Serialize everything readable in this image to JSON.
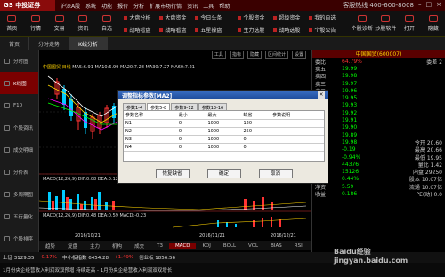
{
  "app": {
    "logo": "GS 中投证券",
    "menu": [
      "沪深A股",
      "系统",
      "功能",
      "报价",
      "分析",
      "扩展市场行情",
      "资讯",
      "工具",
      "帮助"
    ],
    "phone": "客服热线 400-600-8008"
  },
  "toolbar": {
    "buttons": [
      {
        "label": "首页"
      },
      {
        "label": "行情"
      },
      {
        "label": "交易"
      },
      {
        "label": "资讯"
      },
      {
        "label": "自选"
      }
    ],
    "groups": [
      [
        "大盘分析",
        "大盘资金",
        "今日头条"
      ],
      [
        "战略看盘",
        "战略看盘",
        "五星操盘"
      ],
      [
        "个股资金",
        "超级资金",
        "我的自选"
      ],
      [
        "主力选股",
        "战略选股",
        "个股公告"
      ]
    ],
    "right": [
      "个股诊断",
      "炒股软件",
      "打开",
      "隐藏"
    ]
  },
  "tabs": [
    "首页",
    "分时走势",
    "K线分析"
  ],
  "sidebar": [
    "分时图",
    "K线图",
    "F10",
    "个股资讯",
    "成交明细",
    "分价表",
    "多周期图",
    "五行量化",
    "个股排序"
  ],
  "chart": {
    "stock": "中国国贸 日线",
    "ma": "MA5:6.91 MA10:6.99 MA20:7.28 MA30:7.27 MA60:7.21",
    "links": [
      "工具",
      "指标",
      "隐藏",
      "区间统计",
      "设置"
    ],
    "macd1": "MACD(12,26,9) DIF:0.08 DEA:0.12 MACD:-0.07",
    "macd2": "MACD(12,26,9) DIF:0.48 DEA:0.59 MACD:-0.23",
    "dates": [
      "2016/10/21",
      "2016/11/21",
      "2016/12/21"
    ]
  },
  "bottomtabs": [
    "趋势",
    "复盘",
    "主力",
    "机构",
    "成交",
    "T3",
    "MACD",
    "KDJ",
    "BOLL",
    "VOL",
    "BIAS",
    "RSI"
  ],
  "dialog": {
    "title": "调整指标参数[MA2]",
    "tabs": [
      "参数1-4",
      "参数5-8",
      "参数9-12",
      "参数13-16"
    ],
    "headers": [
      "参数名称",
      "最小",
      "最大",
      "缺省",
      "参数说明"
    ],
    "rows": [
      [
        "N1",
        "0",
        "1000",
        "120",
        ""
      ],
      [
        "N2",
        "0",
        "1000",
        "250",
        ""
      ],
      [
        "N3",
        "0",
        "1000",
        "0",
        ""
      ],
      [
        "N4",
        "0",
        "1000",
        "0",
        ""
      ]
    ],
    "buttons": [
      "恢复缺省",
      "确定",
      "取消"
    ]
  },
  "rpanel": {
    "title": "中国国贸(600007)",
    "rows": [
      [
        "委比",
        "64.79%",
        "委差",
        "2"
      ],
      [
        "卖五",
        "19.99",
        ""
      ],
      [
        "卖四",
        "19.98",
        ""
      ],
      [
        "卖三",
        "19.97",
        ""
      ],
      [
        "卖二",
        "19.96",
        ""
      ],
      [
        "卖一",
        "19.95",
        ""
      ],
      [
        "买一",
        "19.93",
        ""
      ],
      [
        "买二",
        "19.92",
        ""
      ],
      [
        "买三",
        "19.91",
        ""
      ],
      [
        "买四",
        "19.90",
        ""
      ],
      [
        "买五",
        "19.89",
        ""
      ],
      [
        "现价",
        "19.98",
        "今开",
        "20.60"
      ],
      [
        "涨跌",
        "-0.19",
        "最高",
        "20.66"
      ],
      [
        "涨幅",
        "-0.94%",
        "最低",
        "19.95"
      ],
      [
        "总量",
        "44376",
        "量比",
        "1.42"
      ],
      [
        "外盘",
        "15126",
        "内盘",
        "29250"
      ],
      [
        "换手",
        "0.44%",
        "股本",
        "10.07亿"
      ],
      [
        "净资",
        "5.59",
        "流通",
        "10.07亿"
      ],
      [
        "收益",
        "0.186",
        "PE(动)",
        "0.0"
      ]
    ]
  },
  "status": {
    "line1": [
      "上证 3129.35",
      "-0.17%",
      "中小板指数 6454.28",
      "+1.49%",
      "创业板 1856.56"
    ],
    "line2": "1月份央企经营收入利润双双预增 持续走高 - 1月份央企经营收入利润双双增长",
    "wm": "Baidu经验 jingyan.baidu.com"
  }
}
